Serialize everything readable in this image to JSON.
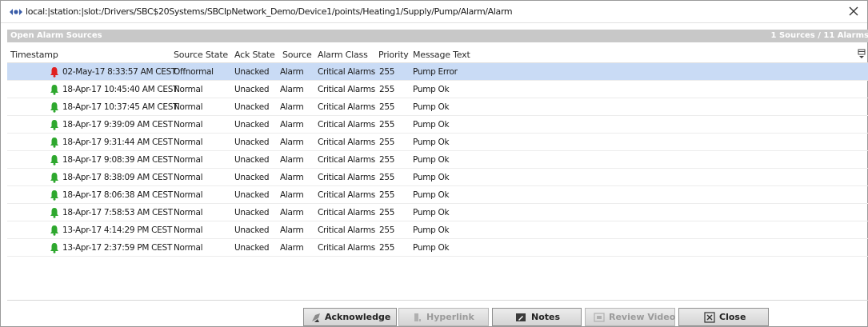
{
  "window": {
    "title": "local:|station:|slot:/Drivers/SBC$20Systems/SBCIpNetwork_Demo/Device1/points/Heating1/Supply/Pump/Alarm/Alarm"
  },
  "header": {
    "left": "Open Alarm Sources",
    "right": "1 Sources / 11 Alarms"
  },
  "columns": [
    "Timestamp",
    "Source State",
    "Ack State",
    "Source",
    "Alarm Class",
    "Priority",
    "Message Text"
  ],
  "rows": [
    {
      "timestamp": "02-May-17 8:33:57 AM CEST",
      "source_state": "Offnormal",
      "ack_state": "Unacked",
      "source": "Alarm",
      "alarm_class": "Critical Alarms",
      "priority": "255",
      "message": "Pump Error",
      "bell_color": "#e02020",
      "selected": true
    },
    {
      "timestamp": "18-Apr-17 10:45:40 AM CEST",
      "source_state": "Normal",
      "ack_state": "Unacked",
      "source": "Alarm",
      "alarm_class": "Critical Alarms",
      "priority": "255",
      "message": "Pump Ok",
      "bell_color": "#2ea82e",
      "selected": false
    },
    {
      "timestamp": "18-Apr-17 10:37:45 AM CEST",
      "source_state": "Normal",
      "ack_state": "Unacked",
      "source": "Alarm",
      "alarm_class": "Critical Alarms",
      "priority": "255",
      "message": "Pump Ok",
      "bell_color": "#2ea82e",
      "selected": false
    },
    {
      "timestamp": "18-Apr-17 9:39:09 AM CEST",
      "source_state": "Normal",
      "ack_state": "Unacked",
      "source": "Alarm",
      "alarm_class": "Critical Alarms",
      "priority": "255",
      "message": "Pump Ok",
      "bell_color": "#2ea82e",
      "selected": false
    },
    {
      "timestamp": "18-Apr-17 9:31:44 AM CEST",
      "source_state": "Normal",
      "ack_state": "Unacked",
      "source": "Alarm",
      "alarm_class": "Critical Alarms",
      "priority": "255",
      "message": "Pump Ok",
      "bell_color": "#2ea82e",
      "selected": false
    },
    {
      "timestamp": "18-Apr-17 9:08:39 AM CEST",
      "source_state": "Normal",
      "ack_state": "Unacked",
      "source": "Alarm",
      "alarm_class": "Critical Alarms",
      "priority": "255",
      "message": "Pump Ok",
      "bell_color": "#2ea82e",
      "selected": false
    },
    {
      "timestamp": "18-Apr-17 8:38:09 AM CEST",
      "source_state": "Normal",
      "ack_state": "Unacked",
      "source": "Alarm",
      "alarm_class": "Critical Alarms",
      "priority": "255",
      "message": "Pump Ok",
      "bell_color": "#2ea82e",
      "selected": false
    },
    {
      "timestamp": "18-Apr-17 8:06:38 AM CEST",
      "source_state": "Normal",
      "ack_state": "Unacked",
      "source": "Alarm",
      "alarm_class": "Critical Alarms",
      "priority": "255",
      "message": "Pump Ok",
      "bell_color": "#2ea82e",
      "selected": false
    },
    {
      "timestamp": "18-Apr-17 7:58:53 AM CEST",
      "source_state": "Normal",
      "ack_state": "Unacked",
      "source": "Alarm",
      "alarm_class": "Critical Alarms",
      "priority": "255",
      "message": "Pump Ok",
      "bell_color": "#2ea82e",
      "selected": false
    },
    {
      "timestamp": "13-Apr-17 4:14:29 PM CEST",
      "source_state": "Normal",
      "ack_state": "Unacked",
      "source": "Alarm",
      "alarm_class": "Critical Alarms",
      "priority": "255",
      "message": "Pump Ok",
      "bell_color": "#2ea82e",
      "selected": false
    },
    {
      "timestamp": "13-Apr-17 2:37:59 PM CEST",
      "source_state": "Normal",
      "ack_state": "Unacked",
      "source": "Alarm",
      "alarm_class": "Critical Alarms",
      "priority": "255",
      "message": "Pump Ok",
      "bell_color": "#2ea82e",
      "selected": false
    }
  ],
  "buttons": [
    {
      "label": "Acknowledge",
      "icon": "acknowledge-icon",
      "enabled": true
    },
    {
      "label": "Hyperlink",
      "icon": "hyperlink-icon",
      "enabled": false
    },
    {
      "label": "Notes",
      "icon": "notes-icon",
      "enabled": true
    },
    {
      "label": "Review Video",
      "icon": "video-icon",
      "enabled": false
    },
    {
      "label": "Close",
      "icon": "close-box-icon",
      "enabled": true
    }
  ]
}
